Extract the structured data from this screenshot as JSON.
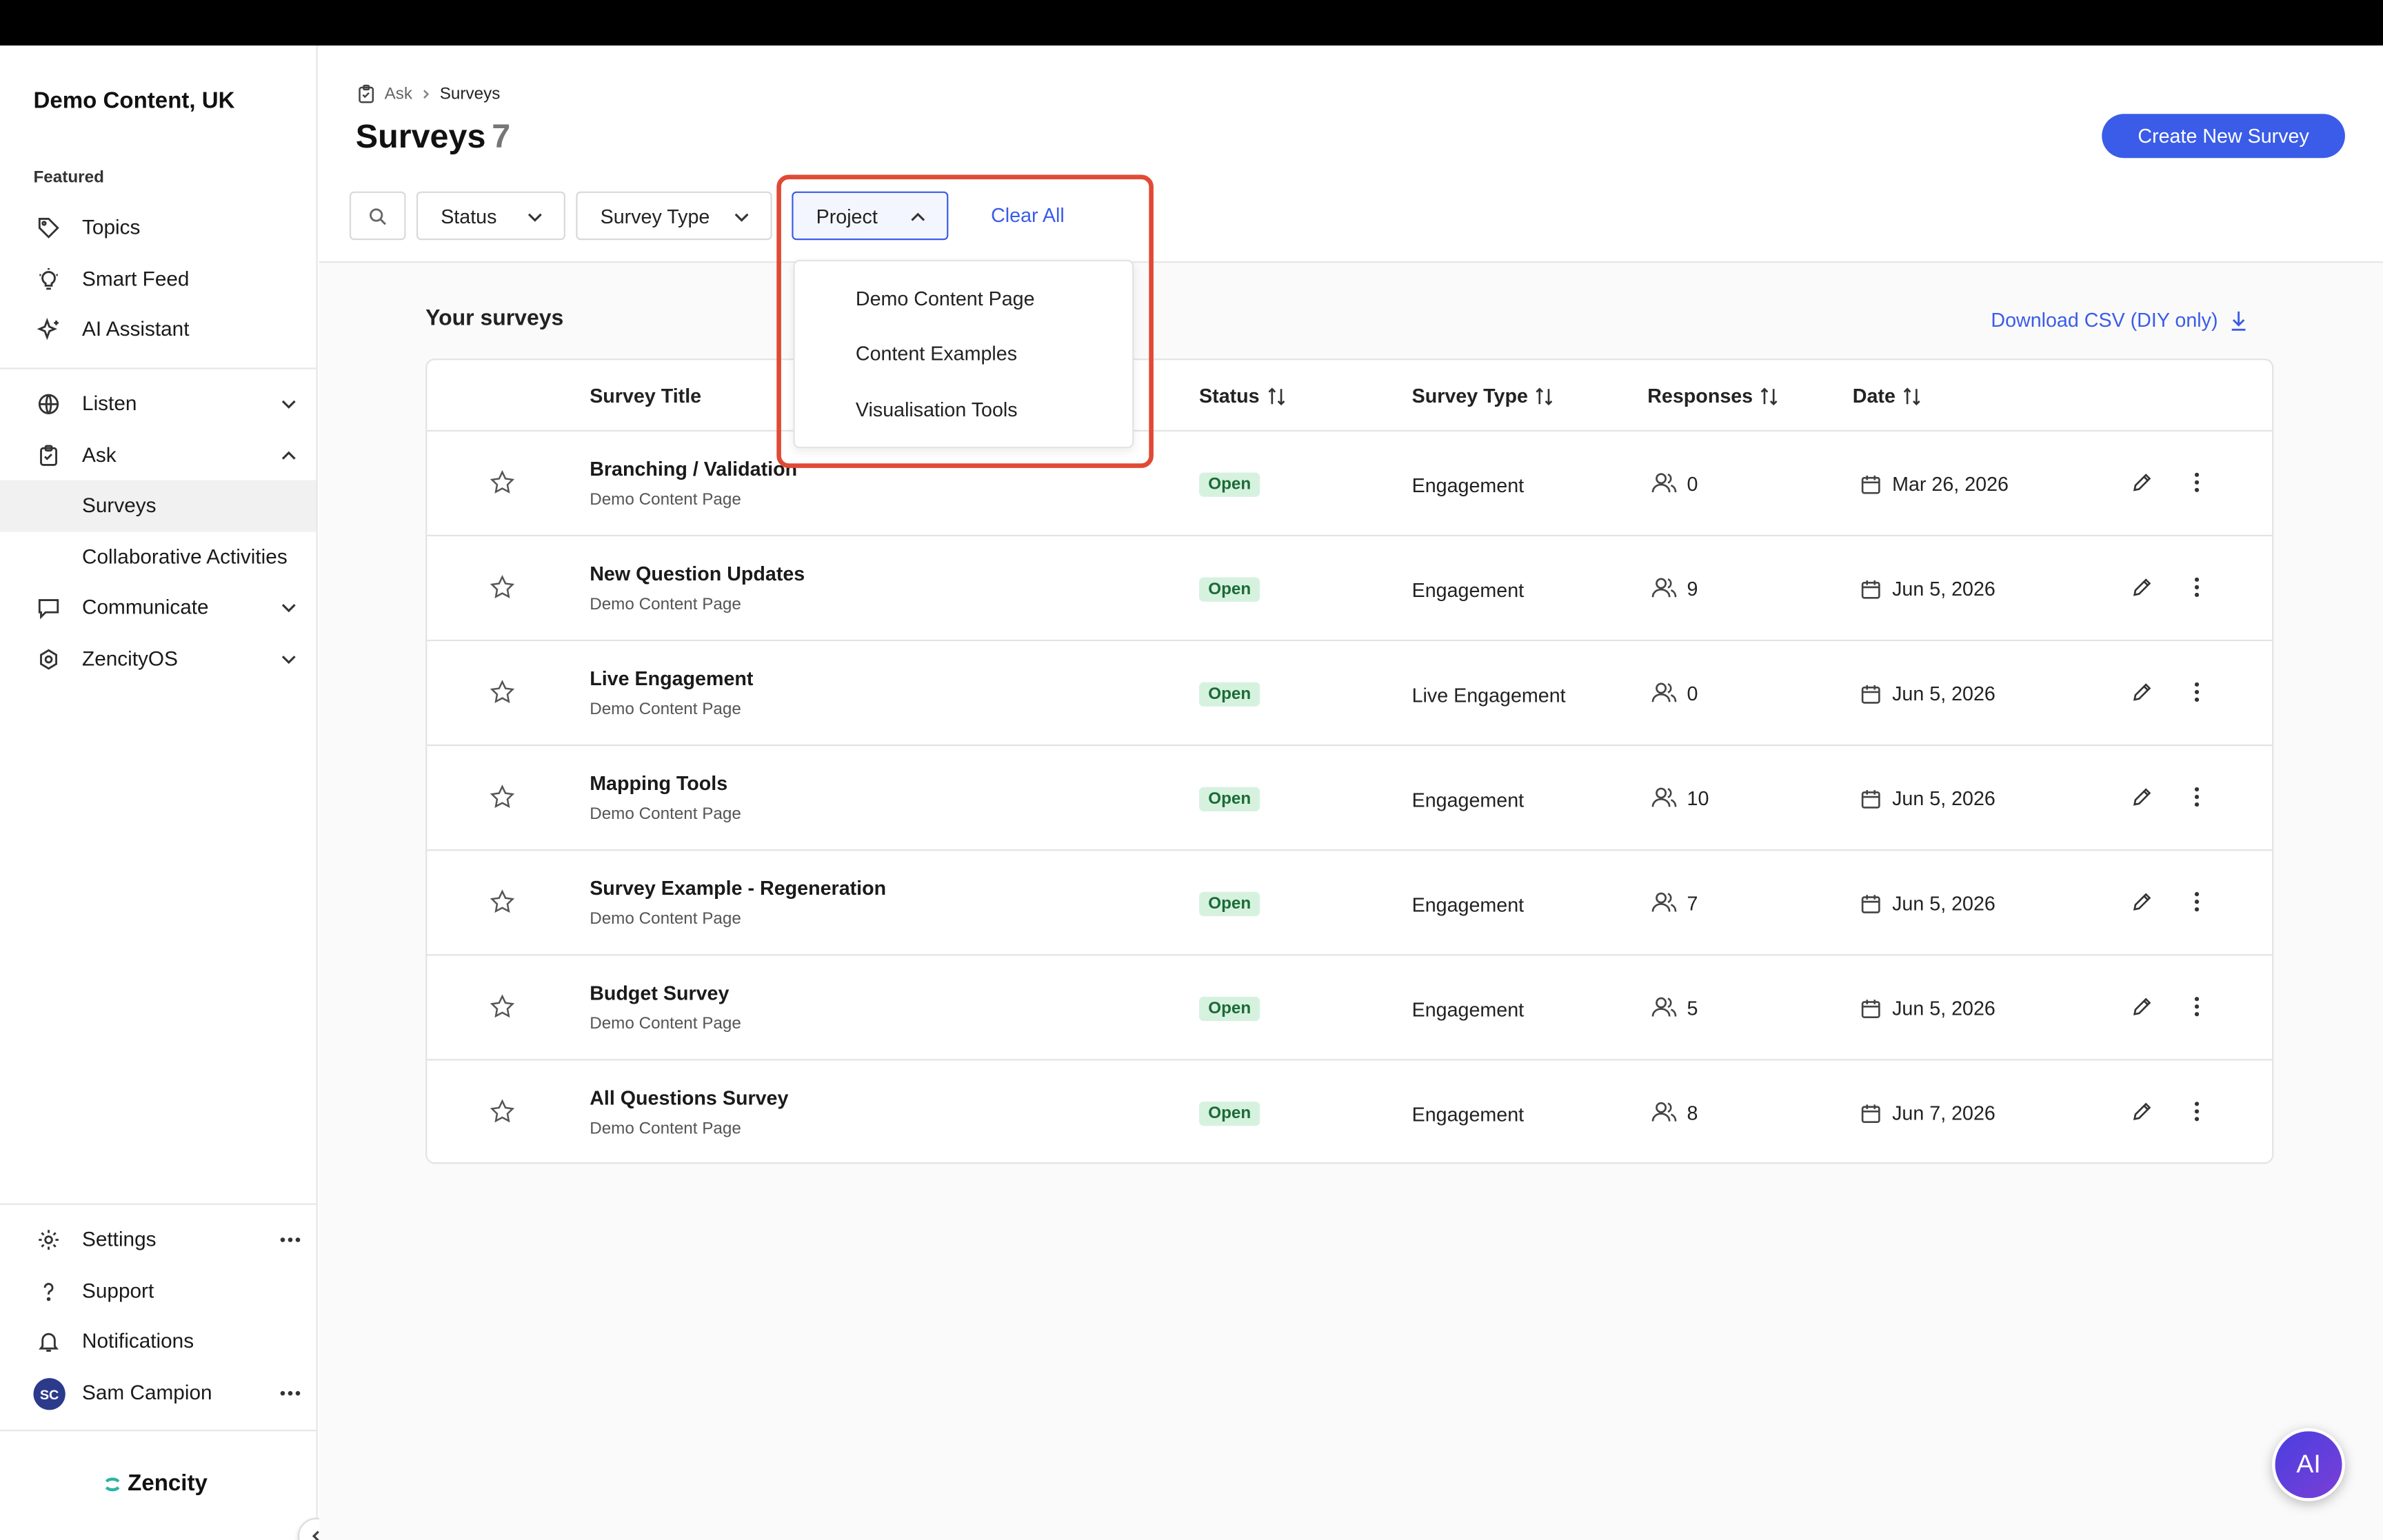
{
  "sidebar": {
    "org_name": "Demo Content, UK",
    "featured_label": "Featured",
    "items": [
      {
        "label": "Topics",
        "icon": "tag-icon"
      },
      {
        "label": "Smart Feed",
        "icon": "lightbulb-icon"
      },
      {
        "label": "AI Assistant",
        "icon": "sparkle-icon"
      },
      {
        "label": "Listen",
        "icon": "globe-icon"
      },
      {
        "label": "Ask",
        "icon": "clipboard-icon"
      },
      {
        "label": "Surveys"
      },
      {
        "label": "Collaborative Activities"
      },
      {
        "label": "Communicate",
        "icon": "chat-icon"
      },
      {
        "label": "ZencityOS",
        "icon": "os-icon"
      }
    ],
    "bottom": [
      {
        "label": "Settings",
        "icon": "gear-icon"
      },
      {
        "label": "Support",
        "icon": "question-icon"
      },
      {
        "label": "Notifications",
        "icon": "bell-icon"
      },
      {
        "label": "Sam Campion",
        "avatar": "SC"
      }
    ],
    "brand": "Zencity"
  },
  "header": {
    "breadcrumb": [
      "Ask",
      "Surveys"
    ],
    "title": "Surveys",
    "count": "7",
    "create_button": "Create New Survey"
  },
  "filters": {
    "status": "Status",
    "survey_type": "Survey Type",
    "project": "Project",
    "clear_all": "Clear All"
  },
  "project_dropdown": {
    "options": [
      "Demo Content Page",
      "Content Examples",
      "Visualisation Tools"
    ]
  },
  "content": {
    "section_title": "Your surveys",
    "download_label": "Download CSV (DIY only)"
  },
  "table": {
    "headers": {
      "title": "Survey Title",
      "status": "Status",
      "type": "Survey Type",
      "responses": "Responses",
      "date": "Date"
    },
    "rows": [
      {
        "title": "Branching / Validation",
        "project": "Demo Content Page",
        "status": "Open",
        "type": "Engagement",
        "responses": "0",
        "date": "Mar 26, 2026"
      },
      {
        "title": "New Question Updates",
        "project": "Demo Content Page",
        "status": "Open",
        "type": "Engagement",
        "responses": "9",
        "date": "Jun 5, 2026"
      },
      {
        "title": "Live Engagement",
        "project": "Demo Content Page",
        "status": "Open",
        "type": "Live Engagement",
        "responses": "0",
        "date": "Jun 5, 2026"
      },
      {
        "title": "Mapping Tools",
        "project": "Demo Content Page",
        "status": "Open",
        "type": "Engagement",
        "responses": "10",
        "date": "Jun 5, 2026"
      },
      {
        "title": "Survey Example - Regeneration",
        "project": "Demo Content Page",
        "status": "Open",
        "type": "Engagement",
        "responses": "7",
        "date": "Jun 5, 2026"
      },
      {
        "title": "Budget Survey",
        "project": "Demo Content Page",
        "status": "Open",
        "type": "Engagement",
        "responses": "5",
        "date": "Jun 5, 2026"
      },
      {
        "title": "All Questions Survey",
        "project": "Demo Content Page",
        "status": "Open",
        "type": "Engagement",
        "responses": "8",
        "date": "Jun 7, 2026"
      }
    ]
  },
  "ai_button": "AI",
  "colors": {
    "accent": "#3a5ce8",
    "highlight": "#e04a35",
    "open_badge_bg": "#d6f2df",
    "open_badge_text": "#1c6b37"
  }
}
